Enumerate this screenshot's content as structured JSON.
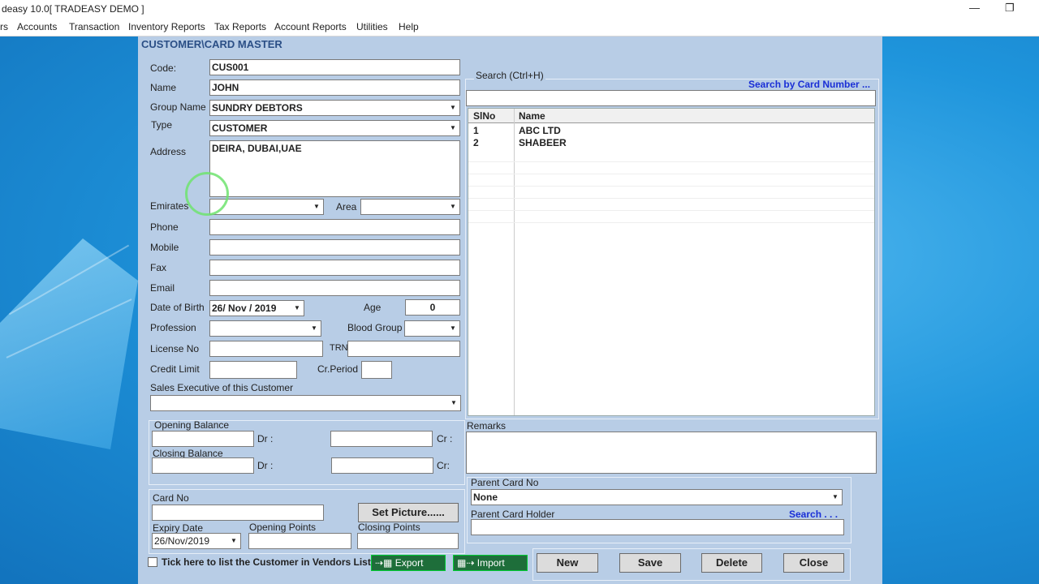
{
  "window": {
    "title": "deasy 10.0[ TRADEASY DEMO ]"
  },
  "menu": [
    "rs",
    "Accounts",
    "Transaction",
    "Inventory Reports",
    "Tax Reports",
    "Account Reports",
    "Utilities",
    "Help"
  ],
  "form": {
    "title": "CUSTOMER\\CARD MASTER",
    "code_label": "Code:",
    "code": "CUS001",
    "name_label": "Name",
    "name": "JOHN",
    "group_label": "Group Name",
    "group": "SUNDRY DEBTORS",
    "type_label": "Type",
    "type": "CUSTOMER",
    "address_label": "Address",
    "address": "DEIRA, DUBAI,UAE",
    "emirates_label": "Emirates",
    "emirates": "",
    "area_label": "Area",
    "area": "",
    "phone_label": "Phone",
    "mobile_label": "Mobile",
    "fax_label": "Fax",
    "email_label": "Email",
    "dob_label": "Date of Birth",
    "dob": "26/ Nov / 2019",
    "age_label": "Age",
    "age": "0",
    "profession_label": "Profession",
    "blood_label": "Blood Group",
    "license_label": "License No",
    "trn_label": "TRN",
    "credit_label": "Credit Limit",
    "crperiod_label": "Cr.Period",
    "salesexec_label": "Sales Executive of this Customer",
    "opening_label": "Opening Balance",
    "closing_label": "Closing Balance",
    "dr_label": "Dr :",
    "cr_label": "Cr :",
    "cr2_label": "Cr:",
    "cardno_label": "Card No",
    "setpic": "Set Picture......",
    "expiry_label": "Expiry Date",
    "expiry": "26/Nov/2019",
    "openpts_label": "Opening Points",
    "closepts_label": "Closing Points",
    "vendors_check": "Tick here to list the Customer in Vendors List",
    "export": "Export",
    "import": "Import"
  },
  "search": {
    "label": "Search (Ctrl+H)",
    "by_card": "Search by Card Number ...",
    "columns": [
      "SlNo",
      "Name"
    ],
    "rows": [
      {
        "no": "1",
        "name": "ABC LTD"
      },
      {
        "no": "2",
        "name": "SHABEER"
      }
    ]
  },
  "remarks_label": "Remarks",
  "parent": {
    "cardno_label": "Parent Card No",
    "cardno": "None",
    "holder_label": "Parent Card Holder",
    "search": "Search . . ."
  },
  "buttons": {
    "new": "New",
    "save": "Save",
    "delete": "Delete",
    "close": "Close"
  }
}
